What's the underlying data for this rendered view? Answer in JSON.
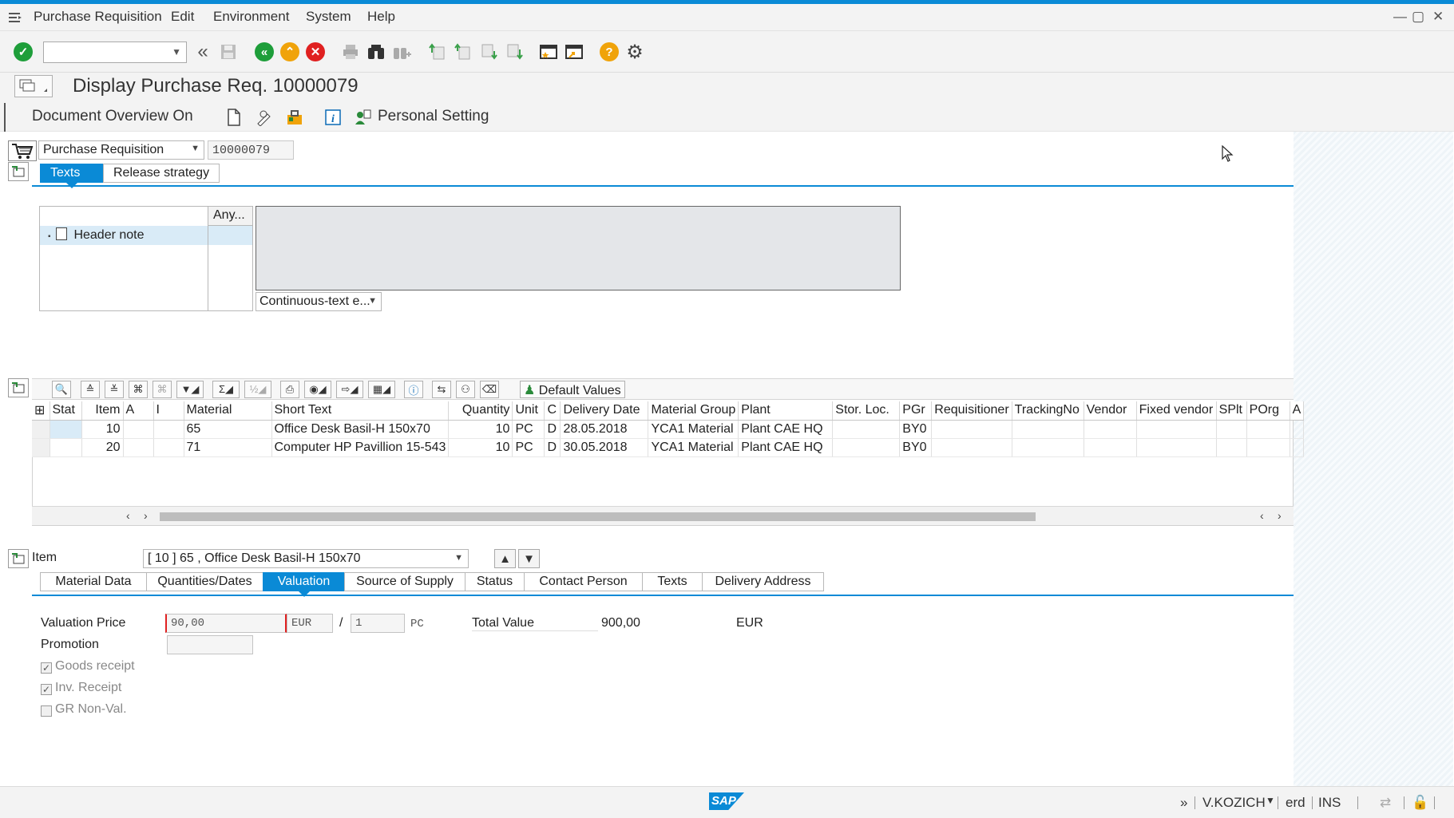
{
  "menu": {
    "items": [
      "Purchase Requisition",
      "Edit",
      "Environment",
      "System",
      "Help"
    ]
  },
  "window_controls": {
    "minimize": "—",
    "maximize": "▢",
    "close": "✕"
  },
  "toolbar": {
    "command_field_value": "",
    "icons": [
      "enter-icon",
      "back-icon",
      "save-icon",
      "back-green-icon",
      "exit-icon",
      "cancel-icon",
      "print-icon",
      "find-icon",
      "find-next-icon",
      "first-page-icon",
      "prev-page-icon",
      "next-page-icon",
      "last-page-icon",
      "new-session-icon",
      "shortcut-icon",
      "help-icon",
      "settings-icon"
    ]
  },
  "title": "Display Purchase Req. 10000079",
  "app_toolbar": {
    "document_overview": "Document Overview On",
    "personal_setting": "Personal Setting"
  },
  "header": {
    "doc_type": "Purchase Requisition",
    "doc_number": "10000079",
    "tabs": [
      "Texts",
      "Release strategy"
    ],
    "active_tab": "Texts"
  },
  "texts": {
    "tree_column_header": "Any...",
    "tree_items": [
      "Header note"
    ],
    "editor_content": "",
    "format": "Continuous-text e..."
  },
  "alv": {
    "default_values_label": "Default Values",
    "columns": [
      "Stat",
      "Item",
      "A",
      "I",
      "Material",
      "Short Text",
      "Quantity",
      "Unit",
      "C",
      "Delivery Date",
      "Material Group",
      "Plant",
      "Stor. Loc.",
      "PGr",
      "Requisitioner",
      "TrackingNo",
      "Vendor",
      "Fixed vendor",
      "SPlt",
      "POrg",
      "A"
    ],
    "rows": [
      {
        "stat": "",
        "item": "10",
        "a": "",
        "i": "",
        "material": "65",
        "short_text": "Office Desk Basil-H 150x70",
        "quantity": "10",
        "unit": "PC",
        "c": "D",
        "delivery_date": "28.05.2018",
        "material_group": "YCA1 Material",
        "plant": "Plant CAE HQ",
        "stor_loc": "",
        "pgr": "BY0",
        "requisitioner": "",
        "tracking_no": "",
        "vendor": "",
        "fixed_vendor": "",
        "splt": "",
        "porg": ""
      },
      {
        "stat": "",
        "item": "20",
        "a": "",
        "i": "",
        "material": "71",
        "short_text": "Computer HP Pavillion 15-543",
        "quantity": "10",
        "unit": "PC",
        "c": "D",
        "delivery_date": "30.05.2018",
        "material_group": "YCA1 Material",
        "plant": "Plant CAE HQ",
        "stor_loc": "",
        "pgr": "BY0",
        "requisitioner": "",
        "tracking_no": "",
        "vendor": "",
        "fixed_vendor": "",
        "splt": "",
        "porg": ""
      }
    ]
  },
  "item_detail": {
    "label": "Item",
    "selected_item": "[ 10 ] 65 , Office Desk Basil-H 150x70",
    "tabs": [
      "Material Data",
      "Quantities/Dates",
      "Valuation",
      "Source of Supply",
      "Status",
      "Contact Person",
      "Texts",
      "Delivery Address"
    ],
    "active_tab": "Valuation",
    "valuation_price_label": "Valuation Price",
    "valuation_price": "90,00",
    "currency": "EUR",
    "per_separator": "/",
    "price_unit": "1",
    "order_unit": "PC",
    "total_value_label": "Total Value",
    "total_value": "900,00",
    "total_currency": "EUR",
    "promotion_label": "Promotion",
    "promotion_value": "",
    "goods_receipt_label": "Goods receipt",
    "goods_receipt_checked": true,
    "inv_receipt_label": "Inv. Receipt",
    "inv_receipt_checked": true,
    "gr_non_val_label": "GR Non-Val.",
    "gr_non_val_checked": false
  },
  "status_bar": {
    "expand": "»",
    "user": "V.KOZICH",
    "system": "erd",
    "mode": "INS"
  },
  "colors": {
    "accent": "#0a8ad6",
    "selection": "#d9ebf7",
    "required": "#e02020"
  }
}
